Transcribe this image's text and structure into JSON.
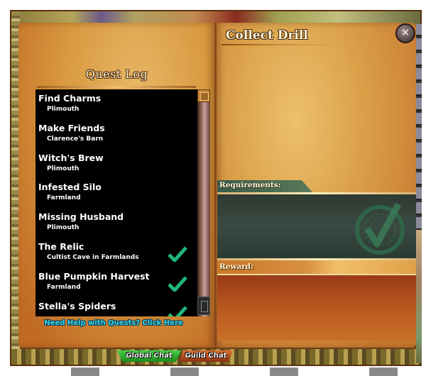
{
  "quest_log": {
    "title": "Quest Log",
    "quests": [
      {
        "name": "Find Charms",
        "location": "Plimouth",
        "completed": false
      },
      {
        "name": "Make Friends",
        "location": "Clarence's Barn",
        "completed": false
      },
      {
        "name": "Witch's Brew",
        "location": "Plimouth",
        "completed": false
      },
      {
        "name": "Infested Silo",
        "location": "Farmland",
        "completed": false
      },
      {
        "name": "Missing Husband",
        "location": "Plimouth",
        "completed": false
      },
      {
        "name": "The Relic",
        "location": "Cultist Cave in Farmlands",
        "completed": true
      },
      {
        "name": "Blue Pumpkin Harvest",
        "location": "Farmland",
        "completed": true
      },
      {
        "name": "Stella's Spiders",
        "location": "",
        "completed": true
      }
    ],
    "help_link": "Need Help with Quests? Click Here"
  },
  "quest_detail": {
    "title": "Collect Drill",
    "requirements_label": "Requirements:",
    "reward_label": "Reward:",
    "close_icon": "close-icon",
    "close_glyph": "✕"
  },
  "chat_tabs": {
    "global": "Global Chat",
    "guild": "Guild Chat"
  },
  "colors": {
    "checkmark": "#1fb87a",
    "help_link": "#38d8e0",
    "global_tab": "#2aa82a",
    "guild_tab": "#c85a20"
  }
}
